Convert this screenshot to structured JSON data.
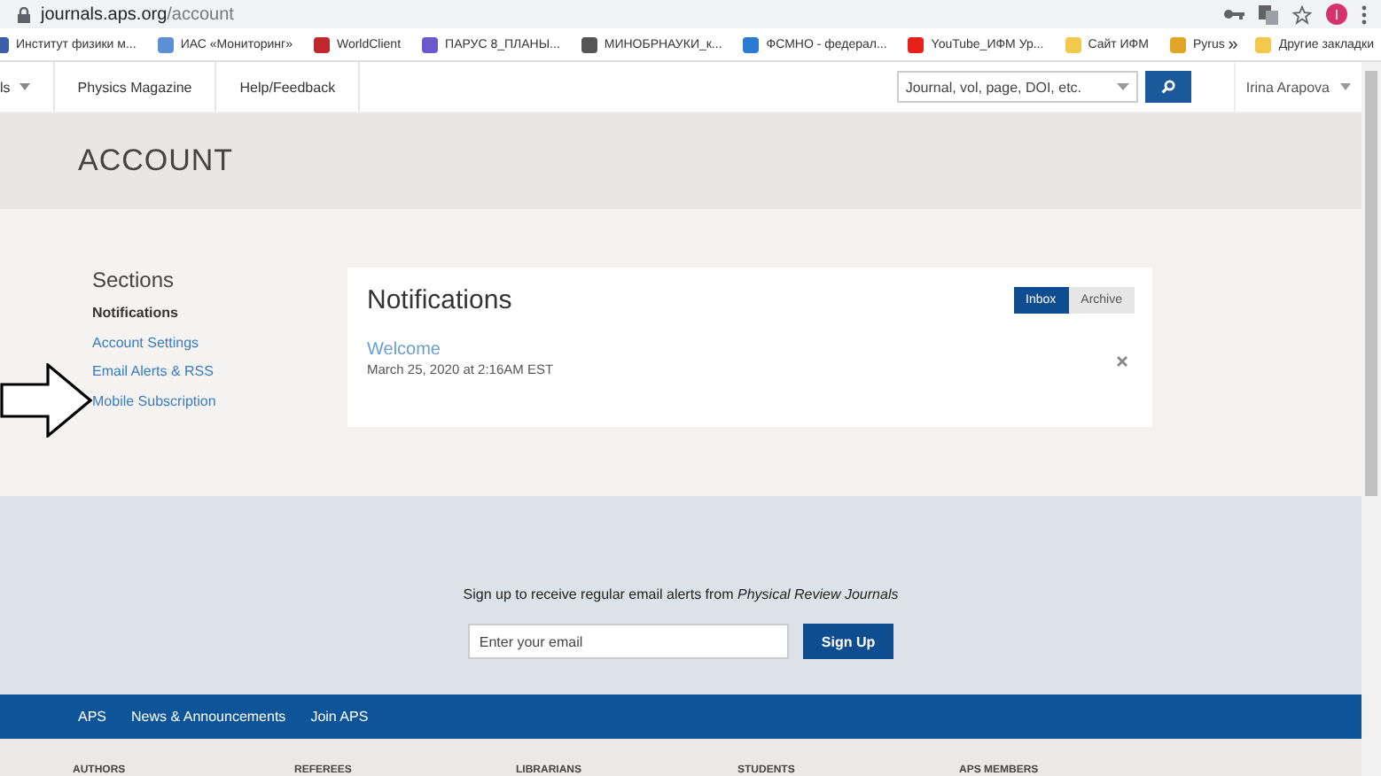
{
  "browser": {
    "url_host": "journals.aps.org",
    "url_path": "/account",
    "profile_initial": "I"
  },
  "bookmarks": [
    {
      "label": "Институт физики м...",
      "color": "#3b5ea8"
    },
    {
      "label": "ИАС «Мониторинг»",
      "color": "#5b8fd6"
    },
    {
      "label": "WorldClient",
      "color": "#c0282d"
    },
    {
      "label": "ПАРУС 8_ПЛАНЫ...",
      "color": "#6a5acd"
    },
    {
      "label": "МИНОБРНАУКИ_к...",
      "color": "#555555"
    },
    {
      "label": "ФСМНО - федерал...",
      "color": "#2a7bd4"
    },
    {
      "label": "YouTube_ИФМ Ур...",
      "color": "#e62117"
    },
    {
      "label": "Сайт ИФМ",
      "color": "#f2c94c"
    },
    {
      "label": "Pyrus",
      "color": "#e0a526"
    }
  ],
  "bookmarks_overflow": "»",
  "other_bookmarks": "Другие закладки",
  "nav": {
    "items": [
      "ls",
      "Physics Magazine",
      "Help/Feedback"
    ],
    "search_placeholder": "Journal, vol, page, DOI, etc.",
    "user": "Irina Arapova"
  },
  "page_title": "ACCOUNT",
  "sidebar": {
    "heading": "Sections",
    "items": [
      {
        "label": "Notifications",
        "selected": true
      },
      {
        "label": "Account Settings",
        "selected": false
      },
      {
        "label": "Email Alerts & RSS",
        "selected": false
      },
      {
        "label": "Mobile Subscription",
        "selected": false
      }
    ]
  },
  "notifications": {
    "title": "Notifications",
    "tabs": [
      {
        "label": "Inbox",
        "selected": true
      },
      {
        "label": "Archive",
        "selected": false
      }
    ],
    "items": [
      {
        "title": "Welcome",
        "date": "March 25, 2020 at 2:16AM EST"
      }
    ]
  },
  "signup": {
    "text": "Sign up to receive regular email alerts from *Physical Review Journals*",
    "placeholder": "Enter your email",
    "button": "Sign Up"
  },
  "footer_links": [
    "APS",
    "News & Announcements",
    "Join APS"
  ],
  "footer_columns": [
    "AUTHORS",
    "REFEREES",
    "LIBRARIANS",
    "STUDENTS",
    "APS MEMBERS"
  ]
}
